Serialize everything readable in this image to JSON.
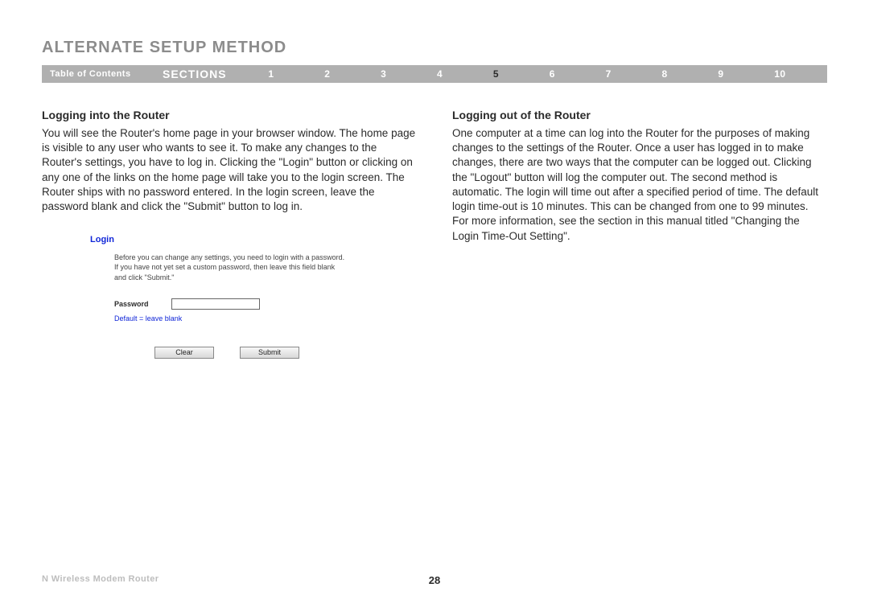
{
  "title": "ALTERNATE SETUP METHOD",
  "nav": {
    "toc": "Table of Contents",
    "sections_label": "SECTIONS",
    "items": [
      "1",
      "2",
      "3",
      "4",
      "5",
      "6",
      "7",
      "8",
      "9",
      "10"
    ],
    "current": "5"
  },
  "left": {
    "heading": "Logging into the Router",
    "body": "You will see the Router's home page in your browser window. The home page is visible to any user who wants to see it. To make any changes to the Router's settings, you have to log in. Clicking the \"Login\" button or clicking on any one of the links on the home page will take you to the login screen. The Router ships with no password entered. In the login screen, leave the password blank and click the \"Submit\" button to log in."
  },
  "login": {
    "title": "Login",
    "instructions": "Before you can change any settings, you need to login with a password. If you have not yet set a custom password, then leave this field blank and click \"Submit.\"",
    "password_label": "Password",
    "hint": "Default = leave blank",
    "clear": "Clear",
    "submit": "Submit"
  },
  "right": {
    "heading": "Logging out of the Router",
    "body": "One computer at a time can log into the Router for the purposes of making changes to the settings of the Router. Once a user has logged in to make changes, there are two ways that the computer can be logged out. Clicking the \"Logout\" button will log the computer out. The second method is automatic. The login will time out after a specified period of time. The default login time-out is 10 minutes. This can be changed from one to 99 minutes. For more information, see the section in this manual titled \"Changing the Login Time-Out Setting\"."
  },
  "footer": {
    "product": "N Wireless Modem Router",
    "page": "28"
  }
}
